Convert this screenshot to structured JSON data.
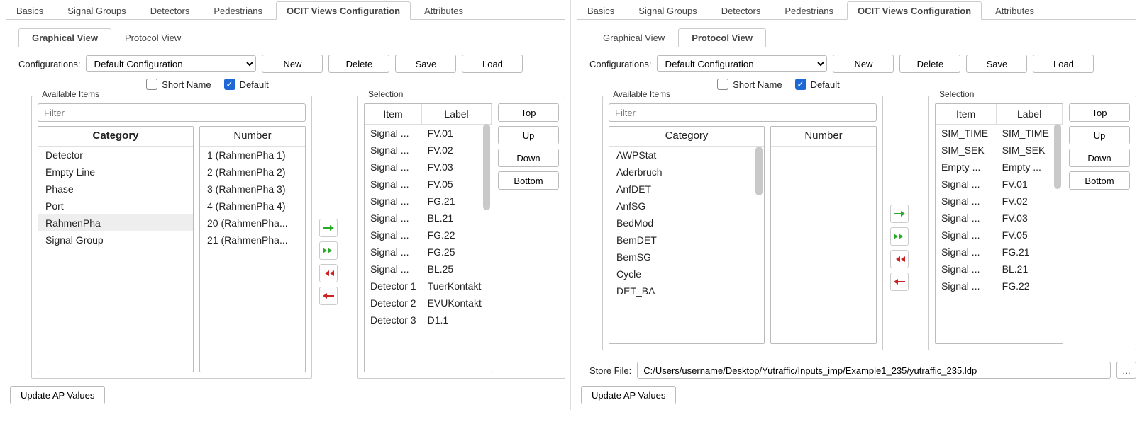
{
  "topTabs": [
    "Basics",
    "Signal Groups",
    "Detectors",
    "Pedestrians",
    "OCIT Views Configuration",
    "Attributes"
  ],
  "activeTopTab": "OCIT Views Configuration",
  "subTabs": {
    "graphical": "Graphical View",
    "protocol": "Protocol View"
  },
  "labels": {
    "configurations": "Configurations:",
    "shortName": "Short Name",
    "default": "Default",
    "availableItems": "Available Items",
    "selection": "Selection",
    "category": "Category",
    "number": "Number",
    "item": "Item",
    "label": "Label",
    "filterPlaceholder": "Filter",
    "storeFile": "Store File:",
    "updateAP": "Update AP Values"
  },
  "buttons": {
    "new": "New",
    "delete": "Delete",
    "save": "Save",
    "load": "Load",
    "top": "Top",
    "up": "Up",
    "down": "Down",
    "bottom": "Bottom",
    "browse": "..."
  },
  "configSelected": "Default Configuration",
  "left": {
    "activeSub": "graphical",
    "categories": [
      "Detector",
      "Empty Line",
      "Phase",
      "Port",
      "RahmenPha",
      "Signal Group"
    ],
    "categorySelected": "RahmenPha",
    "numbers": [
      "1 (RahmenPha 1)",
      "2 (RahmenPha 2)",
      "3 (RahmenPha 3)",
      "4 (RahmenPha 4)",
      "20 (RahmenPha...",
      "21 (RahmenPha..."
    ],
    "selection": [
      {
        "item": "Signal ...",
        "label": "FV.01"
      },
      {
        "item": "Signal ...",
        "label": "FV.02"
      },
      {
        "item": "Signal ...",
        "label": "FV.03"
      },
      {
        "item": "Signal ...",
        "label": "FV.05"
      },
      {
        "item": "Signal ...",
        "label": "FG.21"
      },
      {
        "item": "Signal ...",
        "label": "BL.21"
      },
      {
        "item": "Signal ...",
        "label": "FG.22"
      },
      {
        "item": "Signal ...",
        "label": "FG.25"
      },
      {
        "item": "Signal ...",
        "label": "BL.25"
      },
      {
        "item": "Detector 1",
        "label": "TuerKontakt"
      },
      {
        "item": "Detector 2",
        "label": "EVUKontakt"
      },
      {
        "item": "Detector 3",
        "label": "D1.1"
      }
    ]
  },
  "right": {
    "activeSub": "protocol",
    "categories": [
      "AWPStat",
      "Aderbruch",
      "AnfDET",
      "AnfSG",
      "BedMod",
      "BemDET",
      "BemSG",
      "Cycle",
      "DET_BA"
    ],
    "selection": [
      {
        "item": "SIM_TIME",
        "label": "SIM_TIME"
      },
      {
        "item": "SIM_SEK",
        "label": "SIM_SEK"
      },
      {
        "item": "Empty ...",
        "label": "Empty ..."
      },
      {
        "item": "Signal ...",
        "label": "FV.01"
      },
      {
        "item": "Signal ...",
        "label": "FV.02"
      },
      {
        "item": "Signal ...",
        "label": "FV.03"
      },
      {
        "item": "Signal ...",
        "label": "FV.05"
      },
      {
        "item": "Signal ...",
        "label": "FG.21"
      },
      {
        "item": "Signal ...",
        "label": "BL.21"
      },
      {
        "item": "Signal ...",
        "label": "FG.22"
      }
    ],
    "storeFile": "C:/Users/username/Desktop/Yutraffic/Inputs_imp/Example1_235/yutraffic_235.ldp"
  }
}
